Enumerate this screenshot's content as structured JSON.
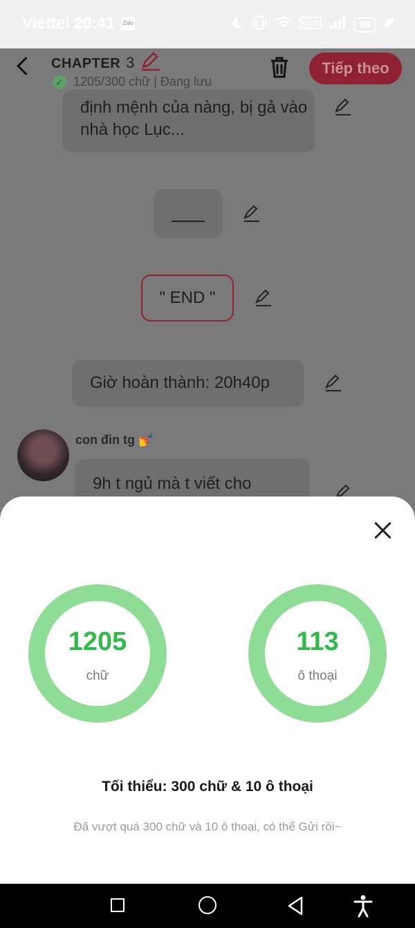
{
  "status_bar": {
    "carrier": "Viettel",
    "time": "20:41",
    "battery": "90"
  },
  "header": {
    "chapter_label": "CHAPTER",
    "chapter_number": "3",
    "save_status": "1205/300 chữ | Đang lưu",
    "next_button": "Tiếp theo"
  },
  "content": {
    "bubble_1": "định mệnh của nàng, bị gả vào nhà học Lục...",
    "bubble_3": "\" END \"",
    "bubble_4": "Giờ hoàn thành: 20h40p",
    "author_name": "con đin tg 💅",
    "bubble_5": "9h t ngủ mà t viết cho"
  },
  "sheet": {
    "words_count": "1205",
    "words_unit": "chữ",
    "dialogs_count": "113",
    "dialogs_unit": "ô thoại",
    "minimum": "Tối thiểu: 300 chữ & 10 ô thoại",
    "hint": "Đã vượt quá 300 chữ và 10 ô thoại, có thể Gửi rồi~",
    "ring_color": "#8edc95",
    "number_color": "#32b848"
  }
}
